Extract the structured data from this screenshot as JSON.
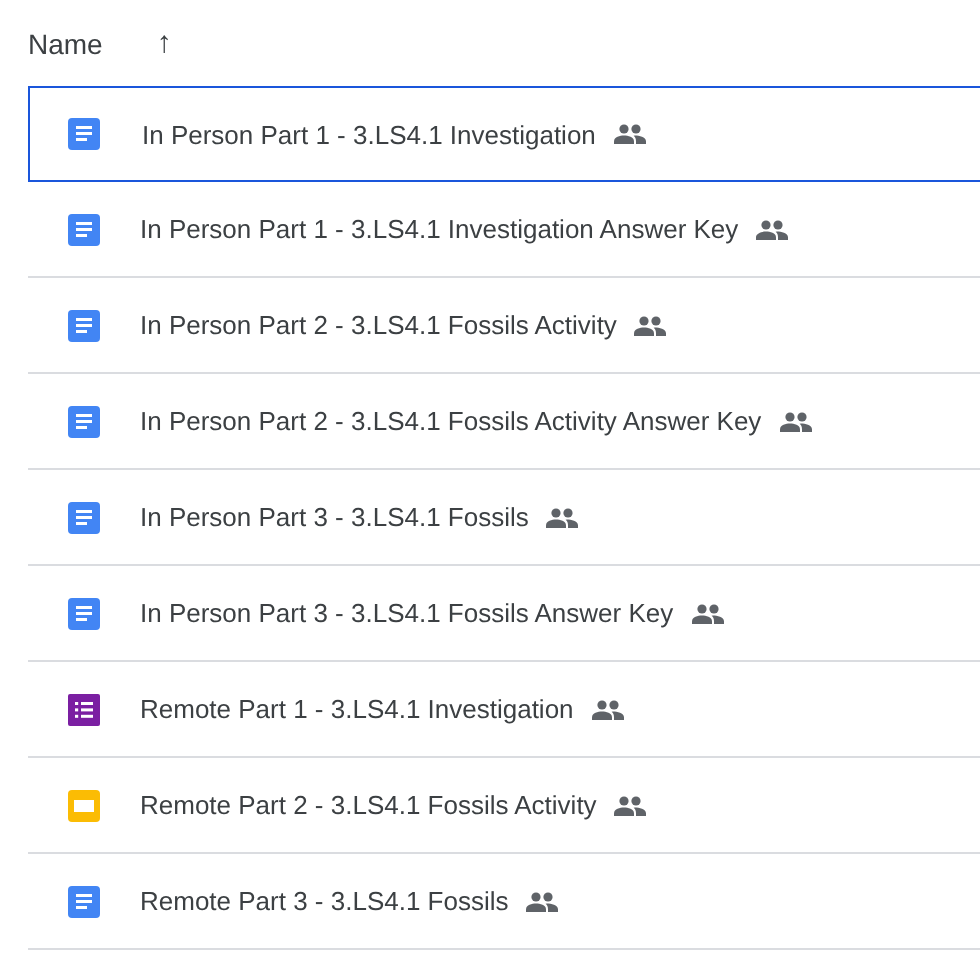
{
  "header": {
    "label": "Name",
    "sort_icon": "↑"
  },
  "files": [
    {
      "name": "In Person Part 1 - 3.LS4.1 Investigation",
      "kind": "doc",
      "shared": true,
      "selected": true
    },
    {
      "name": "In Person Part 1 - 3.LS4.1 Investigation Answer Key",
      "kind": "doc",
      "shared": true,
      "selected": false
    },
    {
      "name": "In Person Part 2 - 3.LS4.1 Fossils Activity",
      "kind": "doc",
      "shared": true,
      "selected": false
    },
    {
      "name": "In Person Part 2 - 3.LS4.1 Fossils Activity Answer Key",
      "kind": "doc",
      "shared": true,
      "selected": false
    },
    {
      "name": "In Person Part 3 - 3.LS4.1 Fossils",
      "kind": "doc",
      "shared": true,
      "selected": false
    },
    {
      "name": "In Person Part 3 - 3.LS4.1 Fossils Answer Key",
      "kind": "doc",
      "shared": true,
      "selected": false
    },
    {
      "name": "Remote Part 1 - 3.LS4.1 Investigation",
      "kind": "form",
      "shared": true,
      "selected": false
    },
    {
      "name": "Remote Part 2 - 3.LS4.1 Fossils Activity",
      "kind": "slides",
      "shared": true,
      "selected": false
    },
    {
      "name": "Remote Part 3 - 3.LS4.1 Fossils",
      "kind": "doc",
      "shared": true,
      "selected": false
    }
  ]
}
